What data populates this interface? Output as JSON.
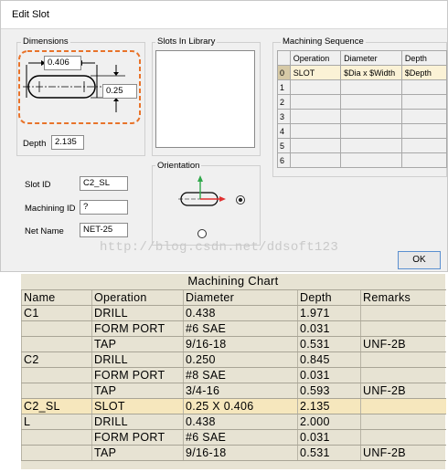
{
  "window": {
    "title": "Edit Slot"
  },
  "dimensions": {
    "label": "Dimensions",
    "length_value": "0.406",
    "width_value": "0.25",
    "depth_label": "Depth",
    "depth_value": "2.135"
  },
  "library": {
    "label": "Slots In Library"
  },
  "ids": {
    "slot_id_label": "Slot ID",
    "slot_id_value": "C2_SL",
    "machining_id_label": "Machining ID",
    "machining_id_value": "?",
    "net_name_label": "Net Name",
    "net_name_value": "NET-25"
  },
  "orientation": {
    "label": "Orientation"
  },
  "sequence": {
    "label": "Machining Sequence",
    "columns": [
      "Operation",
      "Diameter",
      "Depth"
    ],
    "rows": [
      {
        "n": "0",
        "op": "SLOT",
        "dia": "$Dia x $Width",
        "depth": "$Depth"
      },
      {
        "n": "1",
        "op": "",
        "dia": "",
        "depth": ""
      },
      {
        "n": "2",
        "op": "",
        "dia": "",
        "depth": ""
      },
      {
        "n": "3",
        "op": "",
        "dia": "",
        "depth": ""
      },
      {
        "n": "4",
        "op": "",
        "dia": "",
        "depth": ""
      },
      {
        "n": "5",
        "op": "",
        "dia": "",
        "depth": ""
      },
      {
        "n": "6",
        "op": "",
        "dia": "",
        "depth": ""
      }
    ]
  },
  "ok_label": "OK",
  "watermark": "http://blog.csdn.net/ddsoft123",
  "chart": {
    "title": "Machining Chart",
    "columns": [
      "Name",
      "Operation",
      "Diameter",
      "Depth",
      "Remarks"
    ],
    "rows": [
      {
        "name": "C1",
        "op": "DRILL",
        "dia": "0.438",
        "depth": "1.971",
        "remarks": ""
      },
      {
        "name": "",
        "op": "FORM PORT",
        "dia": "#6 SAE",
        "depth": "0.031",
        "remarks": ""
      },
      {
        "name": "",
        "op": "TAP",
        "dia": "9/16-18",
        "depth": "0.531",
        "remarks": "UNF-2B"
      },
      {
        "name": "C2",
        "op": "DRILL",
        "dia": "0.250",
        "depth": "0.845",
        "remarks": ""
      },
      {
        "name": "",
        "op": "FORM PORT",
        "dia": "#8 SAE",
        "depth": "0.031",
        "remarks": ""
      },
      {
        "name": "",
        "op": "TAP",
        "dia": "3/4-16",
        "depth": "0.593",
        "remarks": "UNF-2B"
      },
      {
        "name": "C2_SL",
        "op": "SLOT",
        "dia": "0.25 X 0.406",
        "depth": "2.135",
        "remarks": ""
      },
      {
        "name": "L",
        "op": "DRILL",
        "dia": "0.438",
        "depth": "2.000",
        "remarks": ""
      },
      {
        "name": "",
        "op": "FORM PORT",
        "dia": "#6 SAE",
        "depth": "0.031",
        "remarks": ""
      },
      {
        "name": "",
        "op": "TAP",
        "dia": "9/16-18",
        "depth": "0.531",
        "remarks": "UNF-2B"
      }
    ],
    "highlight_color": "#f6e7bd"
  },
  "colors": {
    "accent_orange": "#e8732a",
    "arrow_green": "#2fa84a",
    "arrow_red": "#e03030"
  }
}
